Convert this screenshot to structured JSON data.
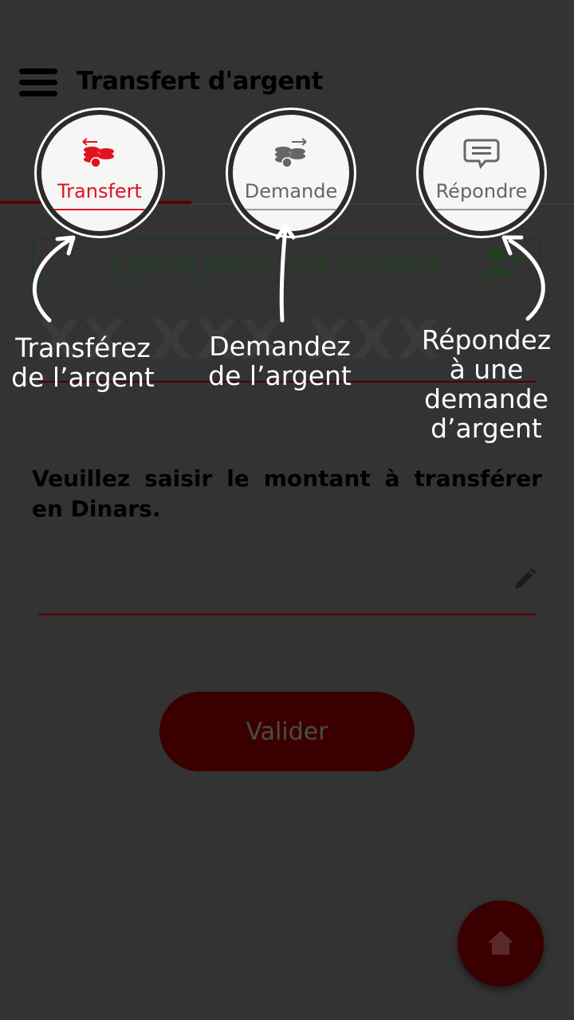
{
  "header": {
    "title": "Transfert d'argent"
  },
  "tabs": [
    {
      "label": "Transfert",
      "color": "#e0141e",
      "icon": "coins-send-icon"
    },
    {
      "label": "Demande",
      "color": "#666666",
      "icon": "coins-receive-icon"
    },
    {
      "label": "Répondre",
      "color": "#666666",
      "icon": "chat-bubble-icon"
    }
  ],
  "contacts": {
    "label": "Ajouter parmi mes contacts",
    "icon": "add-user-icon"
  },
  "phone": {
    "placeholder": "XX XXX XXX"
  },
  "annotations": {
    "transfer": [
      "Transférez",
      "de l’argent"
    ],
    "request": [
      "Demandez",
      "de l’argent"
    ],
    "reply": [
      "Répondez",
      "à une",
      "demande",
      "d’argent"
    ]
  },
  "amount": {
    "prompt": "Veuillez saisir le montant à transférer en Dinars.",
    "value": ""
  },
  "validate_label": "Valider",
  "home": {
    "icon": "home-icon"
  },
  "colors": {
    "accent": "#e0141e",
    "dark_red": "#3a0000",
    "overlay": "#333333"
  }
}
